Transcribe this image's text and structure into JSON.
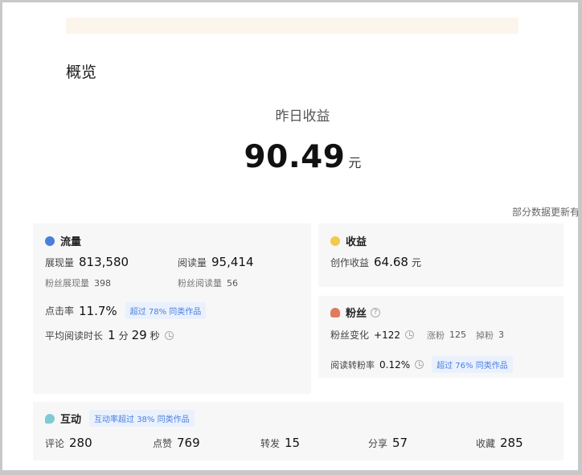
{
  "overview": {
    "title": "概览"
  },
  "income": {
    "label": "昨日收益",
    "value": "90.49",
    "unit": "元"
  },
  "update_note": "部分数据更新有",
  "traffic": {
    "title": "流量",
    "impressions_label": "展现量",
    "impressions_value": "813,580",
    "reads_label": "阅读量",
    "reads_value": "95,414",
    "fan_impressions_label": "粉丝展现量",
    "fan_impressions_value": "398",
    "fan_reads_label": "粉丝阅读量",
    "fan_reads_value": "56",
    "ctr_label": "点击率",
    "ctr_value": "11.7%",
    "ctr_badge": "超过 78% 同类作品",
    "avg_read_label": "平均阅读时长",
    "avg_read_min": "1",
    "min_unit": "分",
    "avg_read_sec": "29",
    "sec_unit": "秒"
  },
  "earnings": {
    "title": "收益",
    "creation_label": "创作收益",
    "creation_value": "64.68",
    "unit": "元"
  },
  "fans": {
    "title": "粉丝",
    "change_label": "粉丝变化",
    "change_value": "+122",
    "gain_label": "涨粉",
    "gain_value": "125",
    "loss_label": "掉粉",
    "loss_value": "3",
    "conversion_label": "阅读转粉率",
    "conversion_value": "0.12%",
    "conversion_badge": "超过 76% 同类作品"
  },
  "interaction": {
    "title": "互动",
    "badge": "互动率超过 38% 同类作品",
    "comments_label": "评论",
    "comments_value": "280",
    "likes_label": "点赞",
    "likes_value": "769",
    "shares_label": "转发",
    "shares_value": "15",
    "shares2_label": "分享",
    "shares2_value": "57",
    "favorites_label": "收藏",
    "favorites_value": "285"
  },
  "colors": {
    "traffic_icon": "#4a7fe0",
    "earnings_icon": "#f2c94c",
    "fans_icon": "#e07a5f",
    "interaction_icon": "#7ecbd6",
    "badge_text": "#4a7fe0",
    "badge_bg": "#eaf1fd"
  }
}
